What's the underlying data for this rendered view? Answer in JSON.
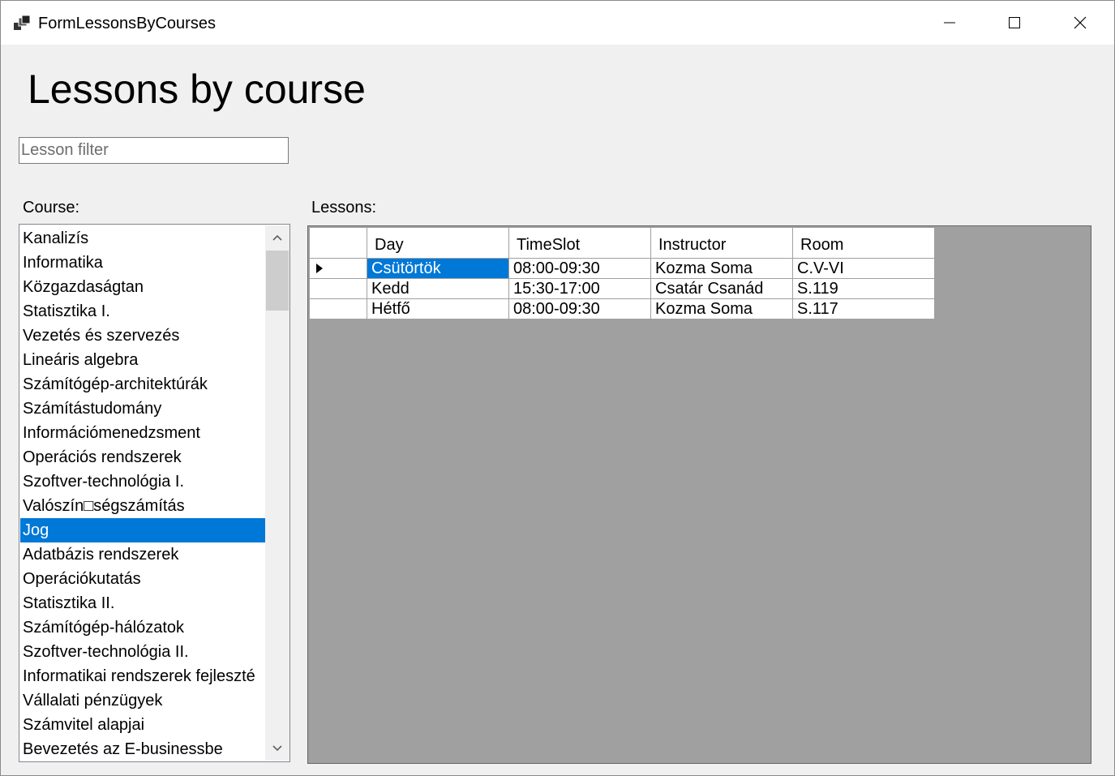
{
  "window": {
    "title": "FormLessonsByCourses"
  },
  "page": {
    "heading": "Lessons by course"
  },
  "filter": {
    "placeholder": "Lesson filter",
    "value": ""
  },
  "course_label": "Course:",
  "lessons_label": "Lessons:",
  "courses": [
    {
      "label": "Kanalizís"
    },
    {
      "label": "Informatika"
    },
    {
      "label": "Közgazdaságtan"
    },
    {
      "label": "Statisztika I."
    },
    {
      "label": "Vezetés és szervezés"
    },
    {
      "label": "Lineáris algebra"
    },
    {
      "label": "Számítógép-architektúrák"
    },
    {
      "label": "Számítástudomány"
    },
    {
      "label": "Információmenedzsment"
    },
    {
      "label": "Operációs rendszerek"
    },
    {
      "label": "Szoftver-technológia I."
    },
    {
      "label": "Valószín□ségszámítás"
    },
    {
      "label": "Jog",
      "selected": true
    },
    {
      "label": "Adatbázis rendszerek"
    },
    {
      "label": "Operációkutatás"
    },
    {
      "label": "Statisztika II."
    },
    {
      "label": "Számítógép-hálózatok"
    },
    {
      "label": "Szoftver-technológia II."
    },
    {
      "label": "Informatikai rendszerek fejleszté"
    },
    {
      "label": "Vállalati pénzügyek"
    },
    {
      "label": "Számvitel alapjai"
    },
    {
      "label": "Bevezetés az E-businessbe"
    }
  ],
  "lessons": {
    "columns": [
      "Day",
      "TimeSlot",
      "Instructor",
      "Room"
    ],
    "rows": [
      {
        "current": true,
        "cells": [
          "Csütörtök",
          "08:00-09:30",
          "Kozma Soma",
          "C.V-VI"
        ]
      },
      {
        "current": false,
        "cells": [
          "Kedd",
          "15:30-17:00",
          "Csatár Csanád",
          "S.119"
        ]
      },
      {
        "current": false,
        "cells": [
          "Hétfő",
          "08:00-09:30",
          "Kozma Soma",
          "S.117"
        ]
      }
    ]
  },
  "colors": {
    "selection": "#0078d7",
    "grid_background": "#a0a0a0",
    "form_background": "#f0f0f0"
  },
  "icons": {
    "app": "app-icon",
    "minimize": "minimize-icon",
    "maximize": "maximize-icon",
    "close": "close-icon",
    "scroll_up": "chevron-up-icon",
    "scroll_down": "chevron-down-icon",
    "row_indicator": "row-indicator-icon"
  }
}
